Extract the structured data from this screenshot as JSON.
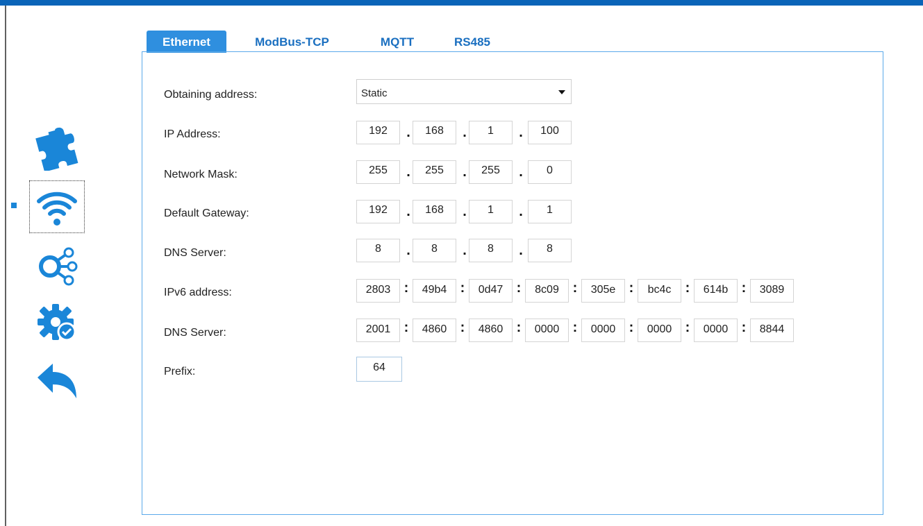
{
  "tabs": [
    "Ethernet",
    "ModBus-TCP",
    "MQTT",
    "RS485"
  ],
  "active_tab": "Ethernet",
  "sidebar": {
    "items": [
      {
        "icon": "puzzle-icon"
      },
      {
        "icon": "wifi-icon",
        "selected": true
      },
      {
        "icon": "network-nodes-icon"
      },
      {
        "icon": "gear-check-icon"
      },
      {
        "icon": "back-arrow-icon"
      }
    ]
  },
  "form": {
    "obtaining_address": {
      "label": "Obtaining address:",
      "value": "Static"
    },
    "ip_address": {
      "label": "IP Address:",
      "octets": [
        "192",
        "168",
        "1",
        "100"
      ]
    },
    "network_mask": {
      "label": "Network Mask:",
      "octets": [
        "255",
        "255",
        "255",
        "0"
      ]
    },
    "default_gateway": {
      "label": "Default Gateway:",
      "octets": [
        "192",
        "168",
        "1",
        "1"
      ]
    },
    "dns_server": {
      "label": "DNS Server:",
      "octets": [
        "8",
        "8",
        "8",
        "8"
      ]
    },
    "ipv6_address": {
      "label": "IPv6 address:",
      "groups": [
        "2803",
        "49b4",
        "0d47",
        "8c09",
        "305e",
        "bc4c",
        "614b",
        "3089"
      ]
    },
    "ipv6_dns_server": {
      "label": "DNS Server:",
      "groups": [
        "2001",
        "4860",
        "4860",
        "0000",
        "0000",
        "0000",
        "0000",
        "8844"
      ]
    },
    "prefix": {
      "label": "Prefix:",
      "value": "64"
    }
  },
  "colors": {
    "accent": "#2f8fdf",
    "top_bar": "#0a64b8",
    "icon": "#1a86d8"
  }
}
